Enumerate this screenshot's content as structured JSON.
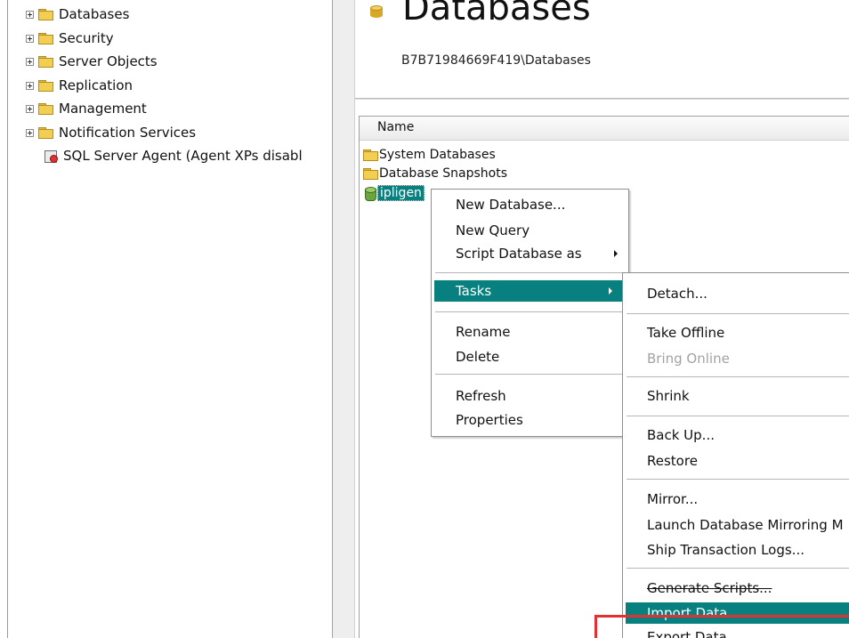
{
  "tree": {
    "items": [
      {
        "label": "Databases"
      },
      {
        "label": "Security"
      },
      {
        "label": "Server Objects"
      },
      {
        "label": "Replication"
      },
      {
        "label": "Management"
      },
      {
        "label": "Notification Services"
      },
      {
        "label": "SQL Server Agent (Agent XPs disabl"
      }
    ]
  },
  "summary": {
    "title": "Databases",
    "path": "B7B71984669F419\\Databases",
    "column_name": "Name",
    "rows": [
      {
        "label": "System Databases"
      },
      {
        "label": "Database Snapshots"
      },
      {
        "label": "ipligen"
      }
    ]
  },
  "context_menu": {
    "items": [
      {
        "label": "New Database..."
      },
      {
        "label": "New Query"
      },
      {
        "label": "Script Database as"
      },
      {
        "label": "Tasks"
      },
      {
        "label": "Rename"
      },
      {
        "label": "Delete"
      },
      {
        "label": "Refresh"
      },
      {
        "label": "Properties"
      }
    ]
  },
  "tasks_menu": {
    "items": [
      {
        "label": "Detach..."
      },
      {
        "label": "Take Offline"
      },
      {
        "label": "Bring Online"
      },
      {
        "label": "Shrink"
      },
      {
        "label": "Back Up..."
      },
      {
        "label": "Restore"
      },
      {
        "label": "Mirror..."
      },
      {
        "label": "Launch Database Mirroring M"
      },
      {
        "label": "Ship Transaction Logs..."
      },
      {
        "label": "Generate Scripts..."
      },
      {
        "label": "Import Data..."
      },
      {
        "label": "Export Data..."
      }
    ]
  },
  "colors": {
    "selection": "#088080",
    "callout": "#e33030"
  }
}
